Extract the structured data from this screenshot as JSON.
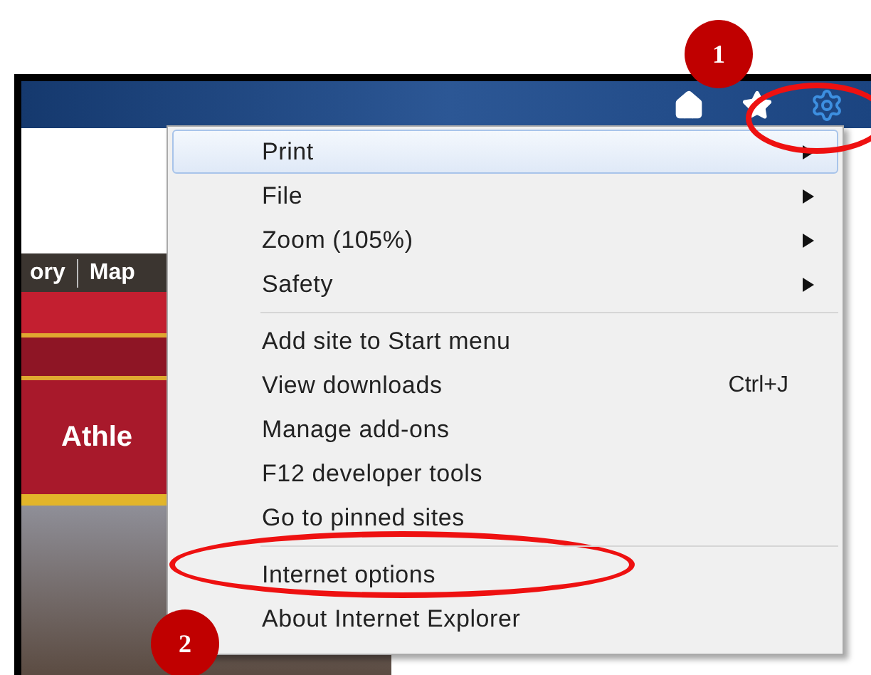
{
  "page": {
    "nav_links": [
      "ory",
      "Map"
    ],
    "banner_text": "Athle"
  },
  "menu": {
    "groups": [
      [
        {
          "label": "Print",
          "submenu": true,
          "selected": true
        },
        {
          "label": "File",
          "submenu": true,
          "selected": false
        },
        {
          "label": "Zoom (105%)",
          "submenu": true,
          "selected": false
        },
        {
          "label": "Safety",
          "submenu": true,
          "selected": false
        }
      ],
      [
        {
          "label": "Add site to Start menu",
          "submenu": false,
          "selected": false
        },
        {
          "label": "View downloads",
          "shortcut": "Ctrl+J",
          "submenu": false,
          "selected": false
        },
        {
          "label": "Manage add-ons",
          "submenu": false,
          "selected": false
        },
        {
          "label": "F12 developer tools",
          "submenu": false,
          "selected": false
        },
        {
          "label": "Go to pinned sites",
          "submenu": false,
          "selected": false
        }
      ],
      [
        {
          "label": "Internet options",
          "submenu": false,
          "selected": false
        },
        {
          "label": "About Internet Explorer",
          "submenu": false,
          "selected": false
        }
      ]
    ]
  },
  "annotations": [
    {
      "label": "1"
    },
    {
      "label": "2"
    }
  ]
}
